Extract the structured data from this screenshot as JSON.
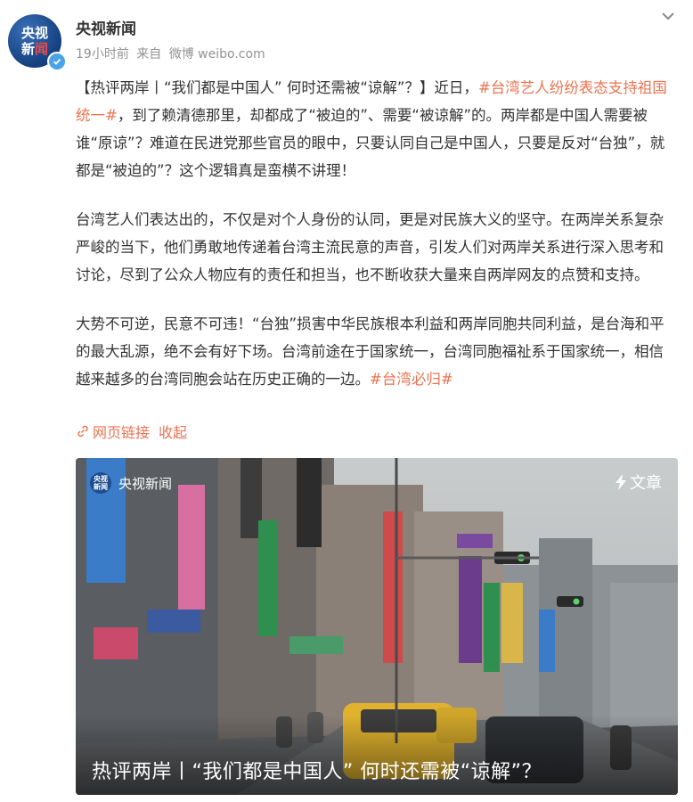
{
  "header": {
    "avatar_line1": "央视",
    "avatar_line2a": "新",
    "avatar_line2b": "闻",
    "username": "央视新闻",
    "time": "19小时前",
    "source_prefix": "来自",
    "source": "微博 weibo.com",
    "icons": {
      "expand": "chevron-down-icon",
      "verified": "verified-badge-icon"
    }
  },
  "post": {
    "p1_a": "【热评两岸丨“我们都是中国人” 何时还需被“谅解”？】近日，",
    "p1_topic": "#台湾艺人纷纷表态支持祖国统一#",
    "p1_b": "，到了赖清德那里，却都成了“被迫的”、需要“被谅解”的。两岸都是中国人需要被谁“原谅”？难道在民进党那些官员的眼中，只要认同自己是中国人，只要是反对“台独”，就都是“被迫的”？这个逻辑真是蛮横不讲理！",
    "p2": "台湾艺人们表达出的，不仅是对个人身份的认同，更是对民族大义的坚守。在两岸关系复杂严峻的当下，他们勇敢地传递着台湾主流民意的声音，引发人们对两岸关系进行深入思考和讨论，尽到了公众人物应有的责任和担当，也不断收获大量来自两岸网友的点赞和支持。",
    "p3_a": "大势不可逆，民意不可违！“台独”损害中华民族根本利益和两岸同胞共同利益，是台海和平的最大乱源，绝不会有好下场。台湾前途在于国家统一，台湾同胞福祉系于国家统一，相信越来越多的台湾同胞会站在历史正确的一边。",
    "p3_topic": "#台湾必归#"
  },
  "links": {
    "web_link": "网页链接",
    "collapse": "收起",
    "icon": "link-icon"
  },
  "card": {
    "source": "央视新闻",
    "logo_line1": "央视",
    "logo_line2": "新闻",
    "tag": "文章",
    "tag_icon": "lightning-icon",
    "title": "热评两岸丨“我们都是中国人” 何时还需被“谅解”？"
  },
  "colors": {
    "accent": "#eb7350",
    "meta_gray": "#939393",
    "brand_blue": "#14407e"
  }
}
